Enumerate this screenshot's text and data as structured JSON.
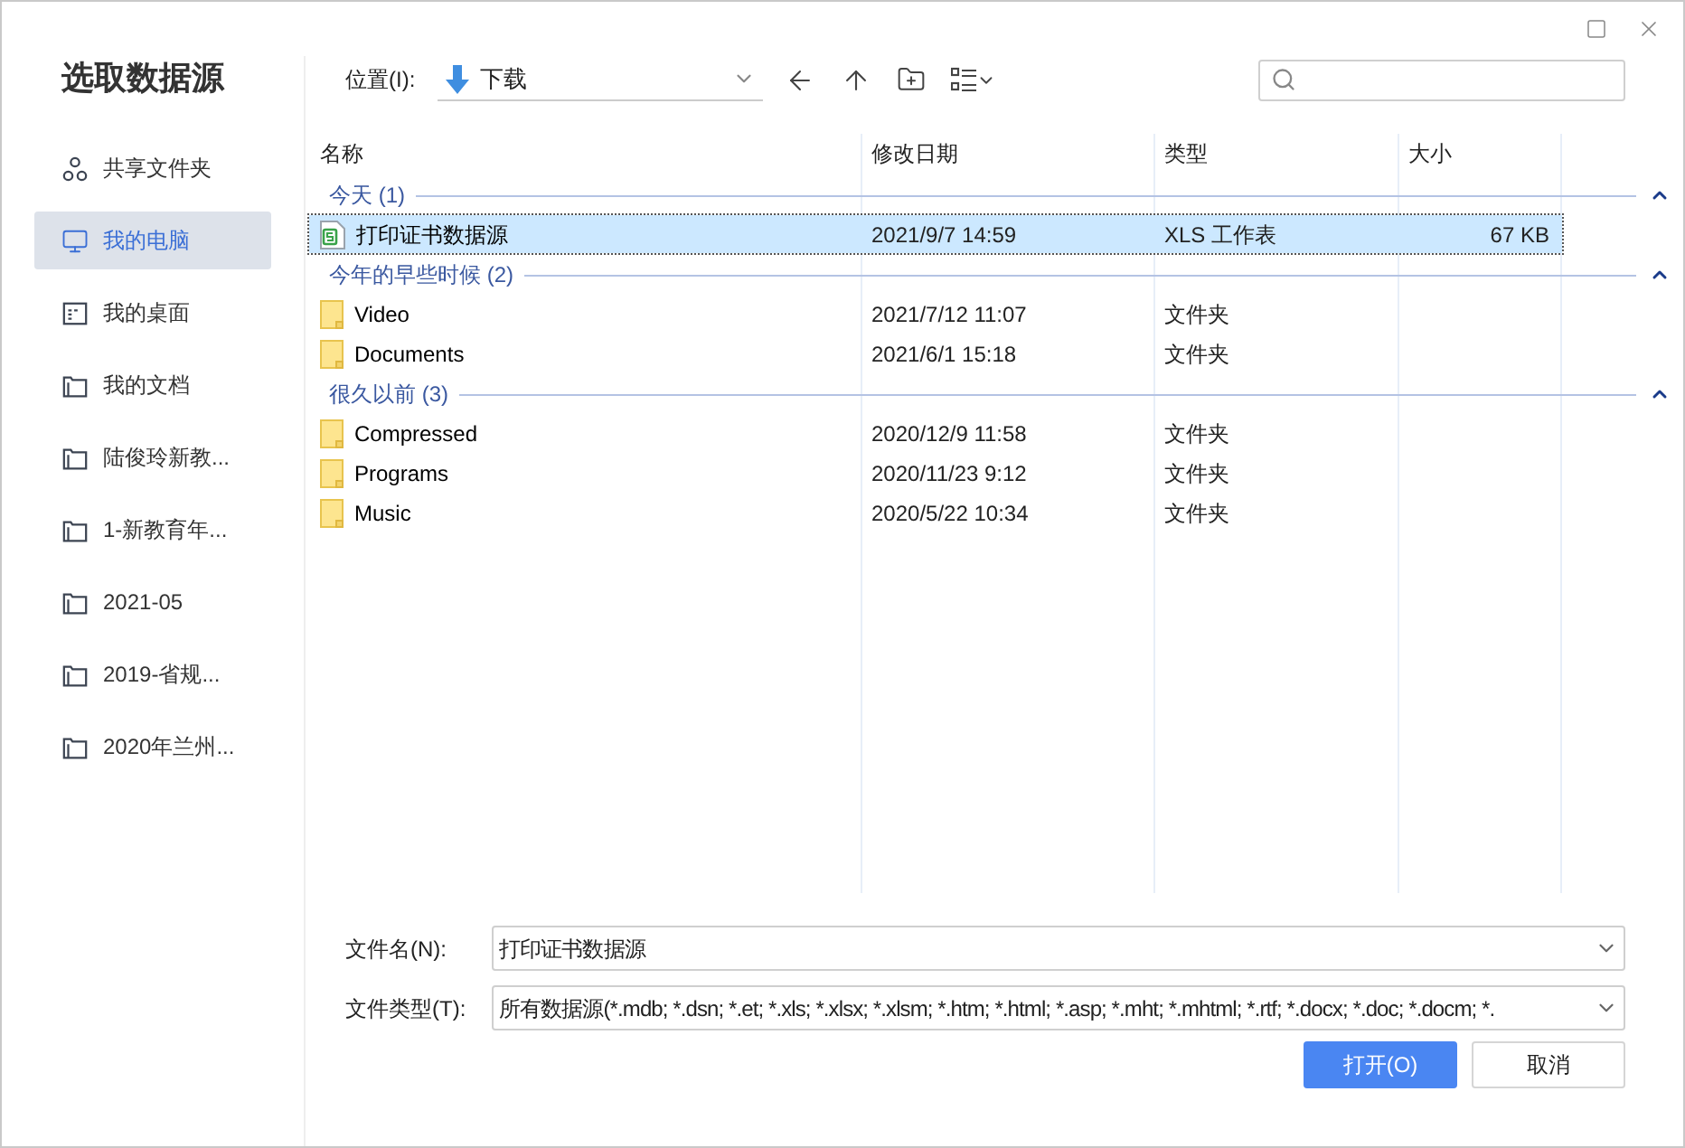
{
  "title": "选取数据源",
  "sidebar": {
    "items": [
      {
        "label": "共享文件夹",
        "kind": "share",
        "selected": false
      },
      {
        "label": "我的电脑",
        "kind": "computer",
        "selected": true
      },
      {
        "label": "我的桌面",
        "kind": "desktop",
        "selected": false
      },
      {
        "label": "我的文档",
        "kind": "folder",
        "selected": false
      },
      {
        "label": "陆俊玲新教...",
        "kind": "folder",
        "selected": false
      },
      {
        "label": "1-新教育年...",
        "kind": "folder",
        "selected": false
      },
      {
        "label": "2021-05",
        "kind": "folder",
        "selected": false
      },
      {
        "label": "2019-省规...",
        "kind": "folder",
        "selected": false
      },
      {
        "label": "2020年兰州...",
        "kind": "folder",
        "selected": false
      }
    ]
  },
  "location": {
    "label": "位置(I):",
    "value": "下载"
  },
  "table": {
    "columns": [
      "名称",
      "修改日期",
      "类型",
      "大小"
    ],
    "groups": [
      {
        "label": "今天 (1)",
        "expanded": true,
        "rows": [
          {
            "kind": "xls",
            "name": "打印证书数据源",
            "date": "2021/9/7 14:59",
            "type": "XLS 工作表",
            "size": "67 KB",
            "selected": true
          }
        ]
      },
      {
        "label": "今年的早些时候 (2)",
        "expanded": true,
        "rows": [
          {
            "kind": "folder",
            "name": "Video",
            "date": "2021/7/12 11:07",
            "type": "文件夹",
            "selected": false
          },
          {
            "kind": "folder",
            "name": "Documents",
            "date": "2021/6/1 15:18",
            "type": "文件夹",
            "selected": false
          }
        ]
      },
      {
        "label": "很久以前 (3)",
        "expanded": true,
        "rows": [
          {
            "kind": "folder",
            "name": "Compressed",
            "date": "2020/12/9 11:58",
            "type": "文件夹",
            "selected": false
          },
          {
            "kind": "folder",
            "name": "Programs",
            "date": "2020/11/23 9:12",
            "type": "文件夹",
            "selected": false
          },
          {
            "kind": "folder",
            "name": "Music",
            "date": "2020/5/22 10:34",
            "type": "文件夹",
            "selected": false
          }
        ]
      }
    ]
  },
  "file_name": {
    "label": "文件名(N):",
    "value": "打印证书数据源"
  },
  "file_type": {
    "label": "文件类型(T):",
    "value": "所有数据源(*.mdb; *.dsn; *.et; *.xls; *.xlsx; *.xlsm; *.htm; *.html; *.asp; *.mht; *.mhtml; *.rtf; *.docx; *.doc; *.docm; *."
  },
  "buttons": [
    {
      "label": "打开(O)",
      "kind": "primary"
    },
    {
      "label": "取消",
      "kind": "secondary"
    }
  ]
}
